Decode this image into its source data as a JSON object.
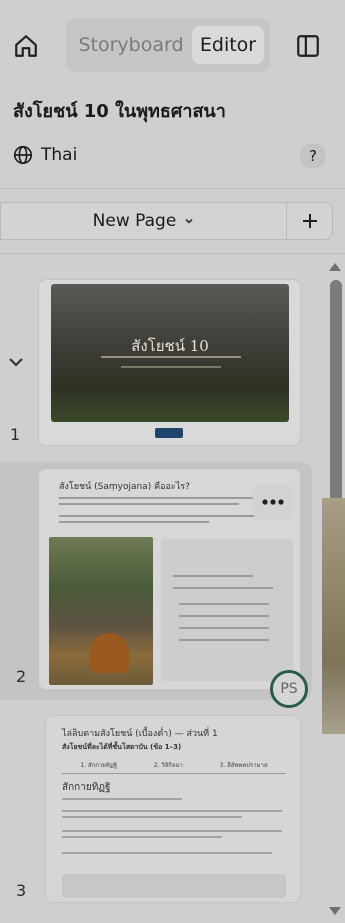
{
  "header": {
    "home_icon": "home-icon",
    "segments": {
      "storyboard": "Storyboard",
      "editor": "Editor",
      "active": "Editor"
    },
    "panel_icon": "panel-toggle-icon"
  },
  "document": {
    "title": "สังโยชน์ 10 ในพุทธศาสนา",
    "language": "Thai",
    "help_label": "?"
  },
  "toolbar": {
    "new_page_label": "New Page",
    "add_label": "+"
  },
  "pages": [
    {
      "number": "1",
      "thumb_title": "สังโยชน์ 10"
    },
    {
      "number": "2",
      "thumb_title": "สังโยชน์ (Saṃyojana) คืออะไร?",
      "avatar_initials": "PS"
    },
    {
      "number": "3",
      "thumb_title": "ไล่ลิบตามสังโยชน์ (เบื้องต่ำ) — ส่วนที่ 1",
      "thumb_subtitle": "สังโยชน์ที่ละได้ที่ชั้นโสดาบัน (ข้อ 1–3)",
      "tabs": [
        "1. สักกายทิฏฐิ",
        "2. วิจิกิจฉา",
        "3. สีลัพพตปรามาส"
      ],
      "section_heading": "สักกายทิฏฐิ"
    }
  ],
  "colors": {
    "accent": "#20446b",
    "avatar_ring": "#2b5a4c"
  }
}
